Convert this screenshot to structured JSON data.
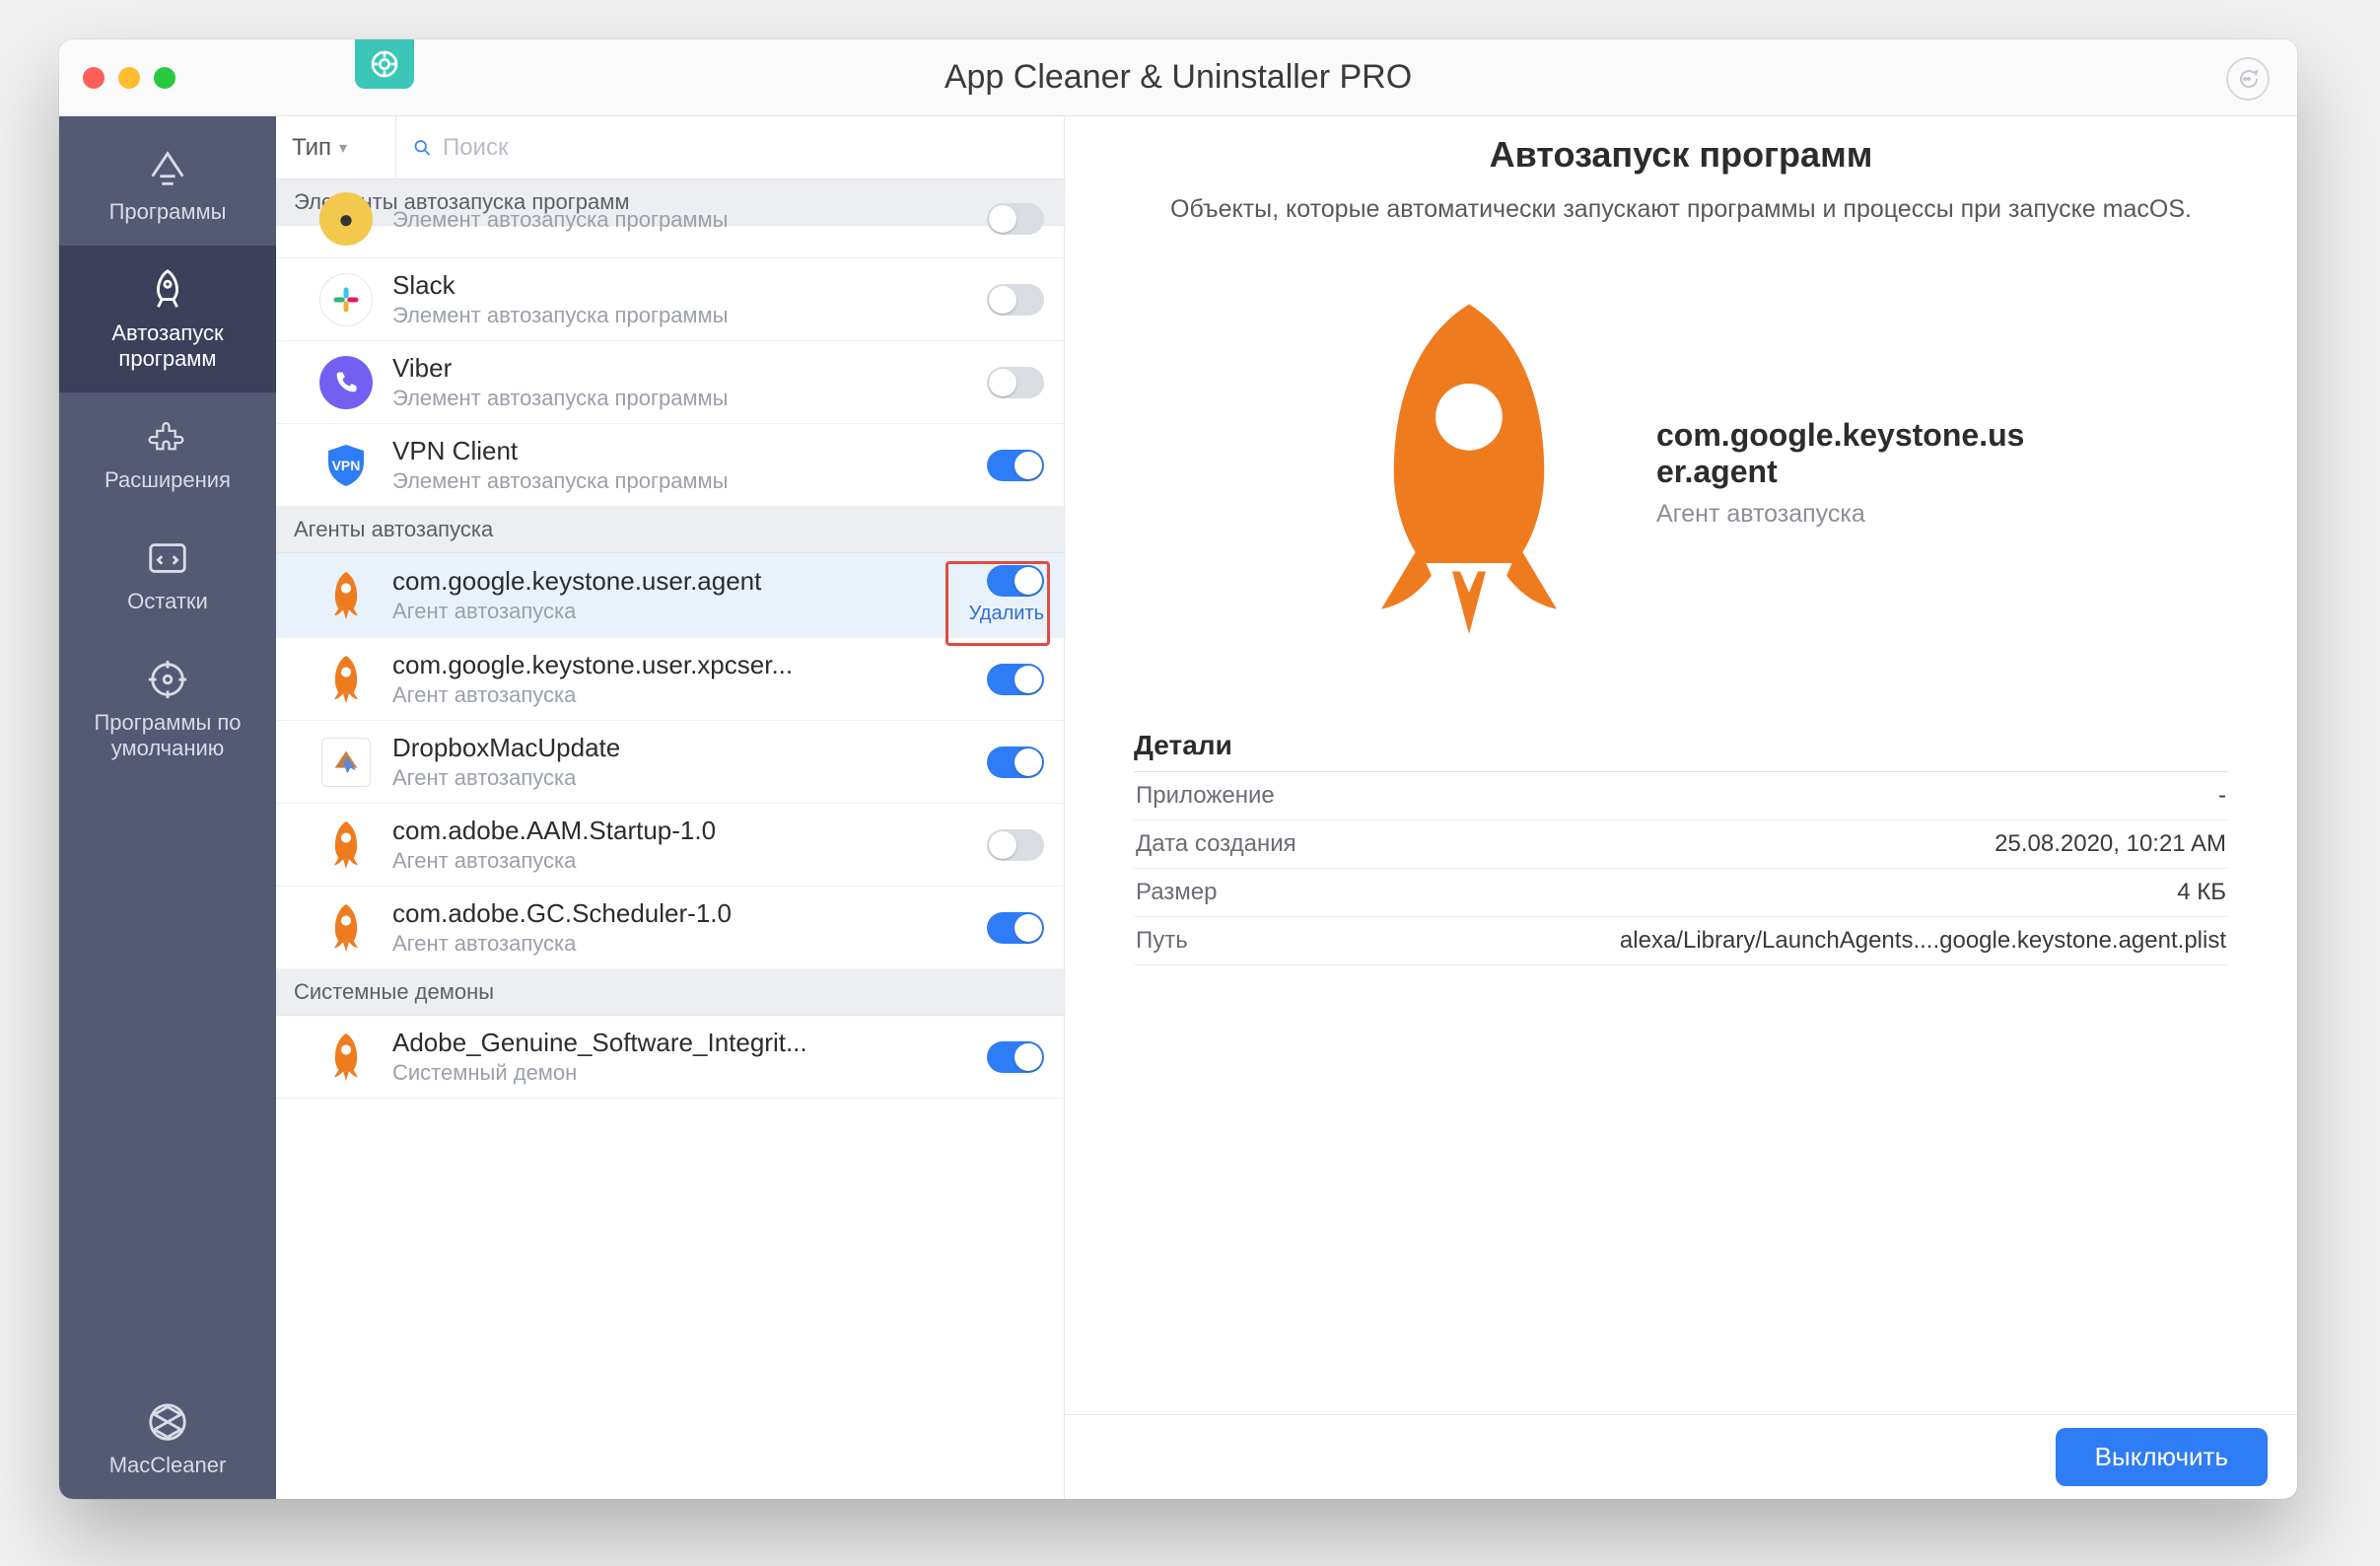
{
  "window": {
    "title": "App Cleaner & Uninstaller PRO"
  },
  "nav": {
    "items": [
      {
        "id": "apps",
        "label": "Программы"
      },
      {
        "id": "startup",
        "label": "Автозапуск программ"
      },
      {
        "id": "ext",
        "label": "Расширения"
      },
      {
        "id": "remains",
        "label": "Остатки"
      },
      {
        "id": "default",
        "label": "Программы по умолчанию"
      }
    ],
    "bottom": {
      "id": "maccleaner",
      "label": "MacCleaner"
    },
    "activeId": "startup"
  },
  "toolbar": {
    "type_label": "Тип",
    "search_placeholder": "Поиск"
  },
  "sections": [
    {
      "title": "Элементы автозапуска программ",
      "items": [
        {
          "icon": "generic",
          "name": "",
          "sub": "Элемент автозапуска программы",
          "on": false,
          "partial_top": true
        },
        {
          "icon": "slack",
          "name": "Slack",
          "sub": "Элемент автозапуска программы",
          "on": false
        },
        {
          "icon": "viber",
          "name": "Viber",
          "sub": "Элемент автозапуска программы",
          "on": false
        },
        {
          "icon": "vpn",
          "name": "VPN Client",
          "sub": "Элемент автозапуска программы",
          "on": true
        }
      ]
    },
    {
      "title": "Агенты автозапуска",
      "items": [
        {
          "icon": "rocket",
          "name": "com.google.keystone.user.agent",
          "sub": "Агент автозапуска",
          "on": true,
          "selected": true,
          "delete_label": "Удалить"
        },
        {
          "icon": "rocket",
          "name": "com.google.keystone.user.xpcser...",
          "sub": "Агент автозапуска",
          "on": true
        },
        {
          "icon": "dropbox",
          "name": "DropboxMacUpdate",
          "sub": "Агент автозапуска",
          "on": true
        },
        {
          "icon": "rocket",
          "name": "com.adobe.AAM.Startup-1.0",
          "sub": "Агент автозапуска",
          "on": false
        },
        {
          "icon": "rocket",
          "name": "com.adobe.GC.Scheduler-1.0",
          "sub": "Агент автозапуска",
          "on": true
        }
      ]
    },
    {
      "title": "Системные демоны",
      "items": [
        {
          "icon": "rocket",
          "name": "Adobe_Genuine_Software_Integrit...",
          "sub": "Системный демон",
          "on": true
        }
      ]
    }
  ],
  "detail": {
    "heading": "Автозапуск программ",
    "description": "Объекты, которые автоматически запускают программы и процессы при запуске macOS.",
    "item_name": "com.google.keystone.user.agent",
    "item_kind": "Агент автозапуска",
    "details_heading": "Детали",
    "rows": [
      {
        "k": "Приложение",
        "v": "-"
      },
      {
        "k": "Дата создания",
        "v": "25.08.2020, 10:21 AM"
      },
      {
        "k": "Размер",
        "v": "4 КБ"
      },
      {
        "k": "Путь",
        "v": "alexa/Library/LaunchAgents....google.keystone.agent.plist"
      }
    ]
  },
  "footer": {
    "primary": "Выключить"
  }
}
